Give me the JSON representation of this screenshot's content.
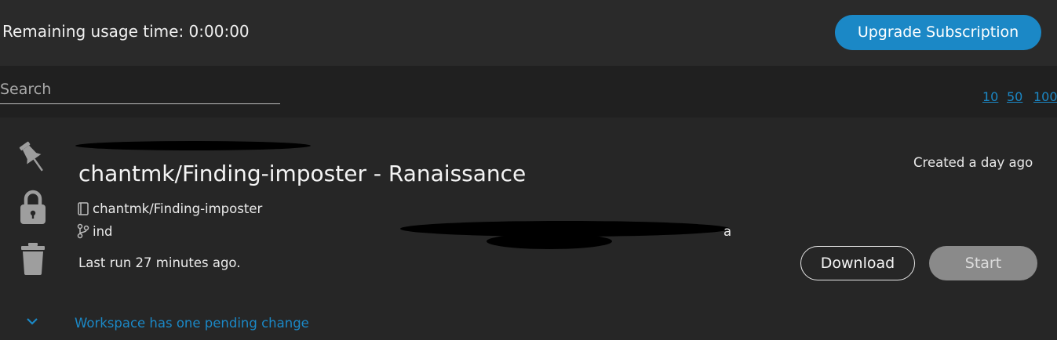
{
  "header": {
    "remaining_label": "Remaining usage time: 0:00:00",
    "upgrade_label": "Upgrade Subscription"
  },
  "search": {
    "placeholder": "Search"
  },
  "page_sizes": [
    "10",
    "50",
    "100"
  ],
  "workspace": {
    "title": "chantmk/Finding-imposter - Ranaissance",
    "repo": "chantmk/Finding-imposter",
    "branch": "ind",
    "branch_tail": "a",
    "created": "Created a day ago",
    "last_run": "Last run 27 minutes ago.",
    "download_label": "Download",
    "start_label": "Start",
    "pending_label": "Workspace has one pending change"
  },
  "icons": {
    "pin": "pin-icon",
    "lock": "lock-icon",
    "trash": "trash-icon",
    "repo": "book-icon",
    "branch": "git-branch-icon",
    "expand": "chevron-down-icon"
  },
  "colors": {
    "accent": "#1b88c6",
    "background": "#262626",
    "header_bg": "#2a2a2a",
    "search_bg": "#202020",
    "disabled_btn": "#8a8a8a"
  }
}
